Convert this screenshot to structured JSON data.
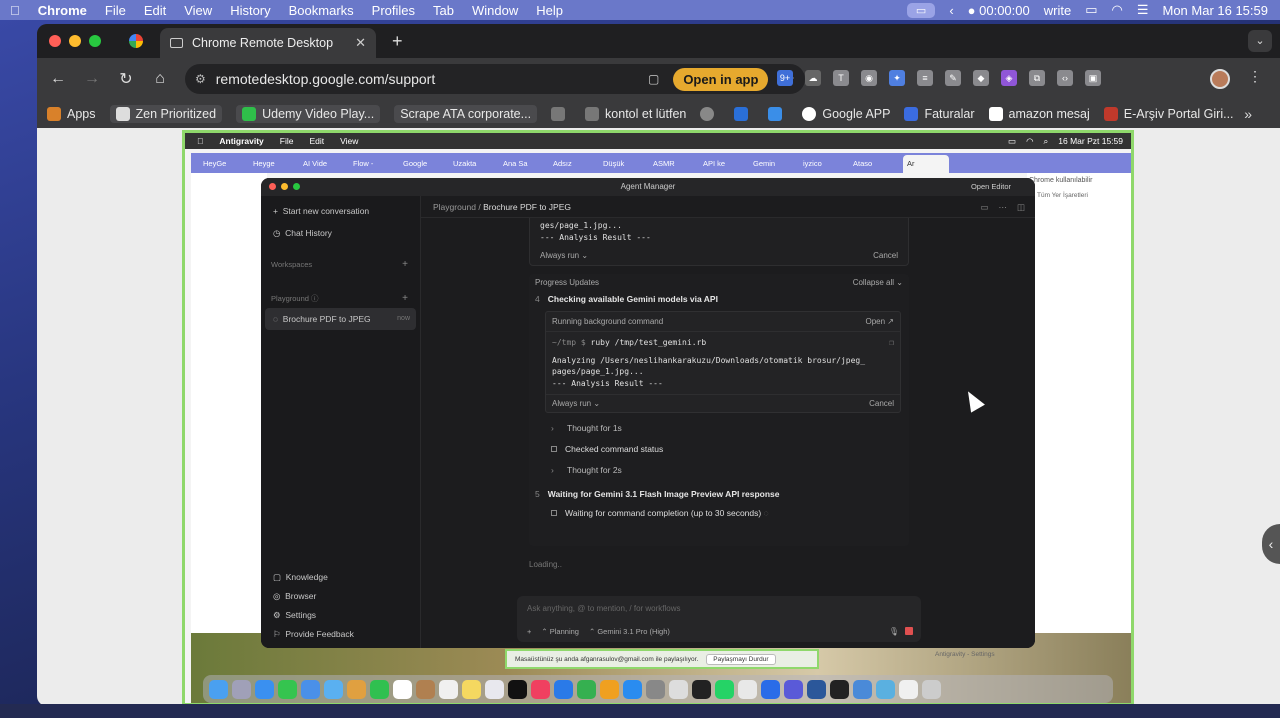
{
  "mac_menubar": {
    "apple": "",
    "app": "Chrome",
    "items": [
      "File",
      "Edit",
      "View",
      "History",
      "Bookmarks",
      "Profiles",
      "Tab",
      "Window",
      "Help"
    ],
    "timer": "00:00:00",
    "write": "write",
    "datetime": "Mon Mar 16  15:59"
  },
  "chrome": {
    "tab_title": "Chrome Remote Desktop",
    "url": "remotedesktop.google.com/support",
    "open_in_app": "Open in app",
    "bookmarks": [
      "Apps",
      "Zen Prioritized",
      "Udemy Video Play...",
      "Scrape ATA corporate...",
      "kontol et lütfen",
      "Google APP",
      "Faturalar",
      "amazon mesaj",
      "E-Arşiv Portal Giri..."
    ]
  },
  "remote": {
    "menubar": {
      "app": "Antigravity",
      "items": [
        "File",
        "Edit",
        "View"
      ],
      "datetime": "16 Mar Pzt  15:59"
    },
    "tabs": [
      "HeyGe",
      "Heyge",
      "AI Vide",
      "Flow -",
      "Google",
      "Uzakta",
      "Ana Sa",
      "Adsız",
      "Düşük",
      "ASMR",
      "API ke",
      "Gemin",
      "iyzico",
      "Ataso",
      "Ar"
    ],
    "right_tab_hint": "Chrome kullanılabilir",
    "right_bookmark_hint": "Tüm Yer İşaretleri"
  },
  "agent": {
    "window_title": "Agent Manager",
    "open_editor": "Open Editor",
    "sidebar": {
      "start_new": "Start new conversation",
      "chat_history": "Chat History",
      "workspaces": "Workspaces",
      "playground": "Playground",
      "conversation": "Brochure PDF to JPEG",
      "conversation_time": "now",
      "footer": [
        "Knowledge",
        "Browser",
        "Settings",
        "Provide Feedback"
      ]
    },
    "breadcrumb": {
      "root": "Playground",
      "current": "Brochure PDF to JPEG"
    },
    "top_output": {
      "line1": "ges/page_1.jpg...",
      "line2": "--- Analysis Result ---",
      "always_run": "Always run",
      "cancel": "Cancel"
    },
    "progress": {
      "header": "Progress Updates",
      "collapse": "Collapse all",
      "step4_num": "4",
      "step4_title": "Checking available Gemini models via API",
      "running_bg": "Running background command",
      "open": "Open",
      "cmd_prompt": "~/tmp $",
      "cmd": "ruby /tmp/test_gemini.rb",
      "out1": "Analyzing /Users/neslihankarakuzu/Downloads/otomatik brosur/jpeg_",
      "out2": "pages/page_1.jpg...",
      "out3": "--- Analysis Result ---",
      "always_run": "Always run",
      "cancel": "Cancel",
      "thought1": "Thought for 1s",
      "checked": "Checked command status",
      "thought2": "Thought for 2s",
      "step5_num": "5",
      "step5_title": "Waiting for Gemini 3.1 Flash Image Preview API response",
      "waiting": "Waiting for command completion (up to 30 seconds)"
    },
    "loading": "Loading..",
    "composer": {
      "placeholder": "Ask anything, @ to mention, / for workflows",
      "plus": "+",
      "mode": "Planning",
      "model": "Gemini 3.1 Pro (High)"
    }
  },
  "share_bar": {
    "text": "Masaüstünüz şu anda afganrasulov@gmail.com ile paylaşılıyor.",
    "button": "Paylaşmayı Durdur"
  },
  "remote_footer_hint": "Antigravity - Settings"
}
